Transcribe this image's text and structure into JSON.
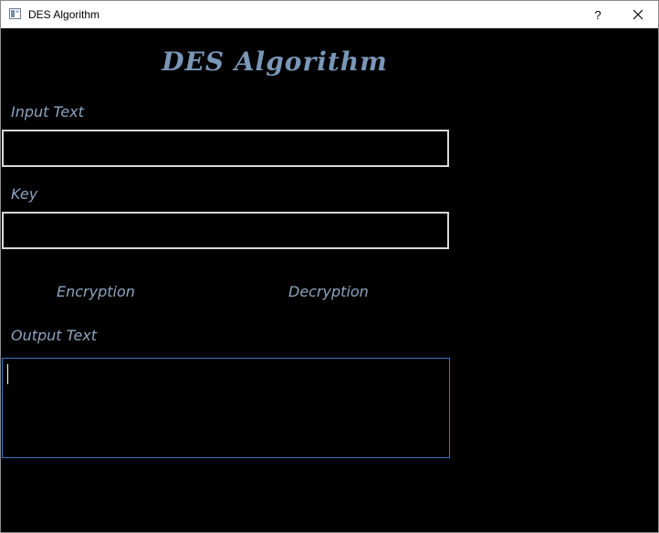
{
  "window": {
    "title": "DES Algorithm",
    "help_label": "?",
    "icon": "window-app-icon"
  },
  "main": {
    "heading": "DES Algorithm",
    "input_label": "Input Text",
    "input_value": "",
    "key_label": "Key",
    "key_value": "",
    "encrypt_label": "Encryption",
    "decrypt_label": "Decryption",
    "output_label": "Output Text",
    "output_value": ""
  },
  "colors": {
    "background": "#000000",
    "label_text": "#8ea4bf",
    "field_border": "#d9d9d9",
    "focus_border": "#3d74cc"
  }
}
